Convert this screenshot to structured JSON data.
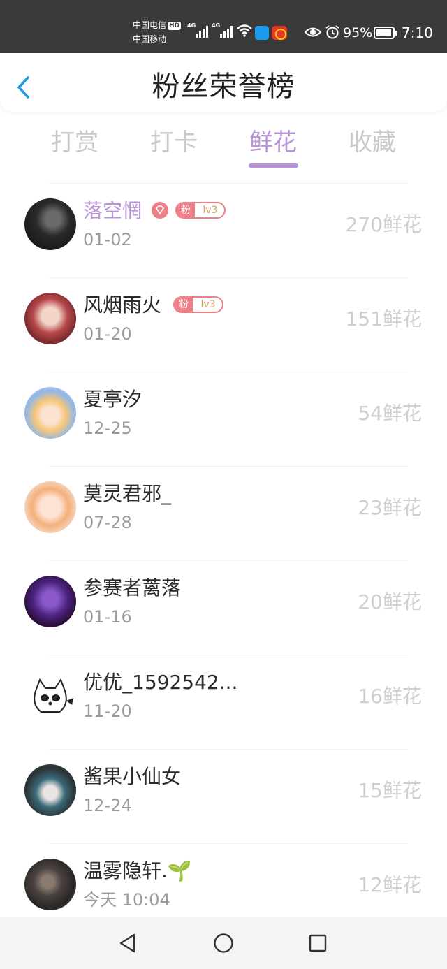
{
  "status_bar": {
    "carrier_1": "中国电信",
    "hd_badge": "HD",
    "carrier_2": "中国移动",
    "net_label_1": "4G",
    "net_label_2": "4G",
    "battery_pct": "95%",
    "time": "7:10",
    "battery_level": 0.95,
    "icons": [
      "signal-icon",
      "signal-icon",
      "wifi-icon",
      "app-notification-icon",
      "weibo-icon",
      "eye-icon",
      "alarm-icon",
      "battery-icon"
    ]
  },
  "header": {
    "title": "粉丝荣誉榜",
    "back_icon": "chevron-left-icon"
  },
  "tabs": [
    {
      "label": "打赏",
      "active": false
    },
    {
      "label": "打卡",
      "active": false
    },
    {
      "label": "鲜花",
      "active": true
    },
    {
      "label": "收藏",
      "active": false
    }
  ],
  "colors": {
    "accent": "#b995d8",
    "badge": "#ef7f86",
    "level_text": "#d6a25a",
    "amount": "#cfcfcf",
    "date": "#9b9b9b"
  },
  "list": [
    {
      "name": "落空惘",
      "date": "01-02",
      "amount": "270鲜花",
      "vip": true,
      "fan_badge": {
        "tag": "粉",
        "level": "lv3"
      }
    },
    {
      "name": "风烟雨火",
      "date": "01-20",
      "amount": "151鲜花",
      "vip": false,
      "fan_badge": {
        "tag": "粉",
        "level": "lv3"
      }
    },
    {
      "name": "夏亭汐",
      "date": "12-25",
      "amount": "54鲜花"
    },
    {
      "name": "莫灵君邪_",
      "date": "07-28",
      "amount": "23鲜花"
    },
    {
      "name": "参赛者蓠落",
      "date": "01-16",
      "amount": "20鲜花"
    },
    {
      "name": "优优_1592542...",
      "date": "11-20",
      "amount": "16鲜花"
    },
    {
      "name": "酱果小仙女",
      "date": "12-24",
      "amount": "15鲜花"
    },
    {
      "name": "温雾隐轩.🌱",
      "date": "今天 10:04",
      "amount": "12鲜花"
    }
  ],
  "navbar": {
    "back_icon": "triangle-back-icon",
    "home_icon": "circle-home-icon",
    "recents_icon": "square-recents-icon"
  }
}
